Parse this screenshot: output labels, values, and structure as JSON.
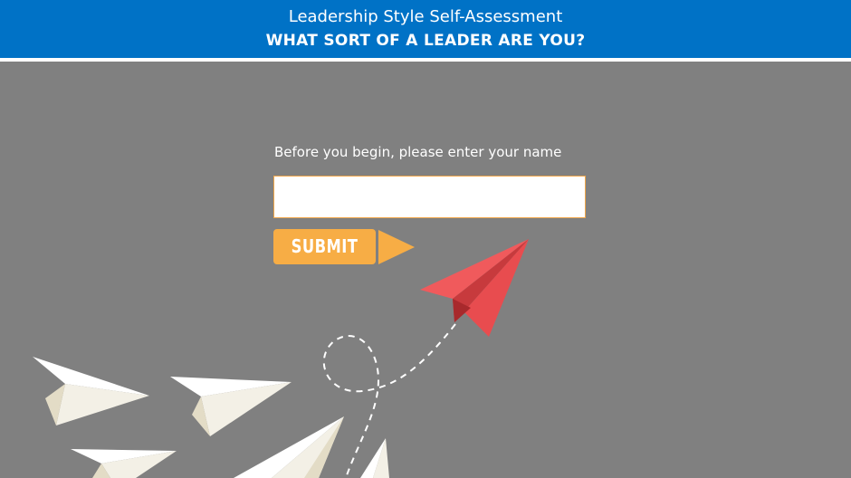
{
  "header": {
    "title": "Leadership Style Self-Assessment",
    "subtitle": "WHAT SORT OF A LEADER ARE YOU?"
  },
  "form": {
    "prompt": "Before you begin, please enter your name",
    "name_value": "",
    "name_placeholder": "",
    "submit_label": "SUBMIT"
  },
  "colors": {
    "header_bg": "#0072c6",
    "page_bg": "#808080",
    "accent": "#f7ad45",
    "leader_plane": "#e84c4f"
  },
  "illustration": {
    "leader_plane_icon": "red-paper-plane-icon",
    "follower_plane_icon": "white-paper-plane-icon"
  }
}
